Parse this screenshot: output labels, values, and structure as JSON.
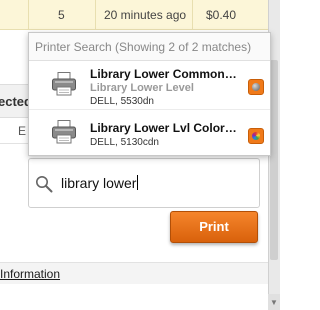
{
  "background_table": {
    "row": {
      "count": "5",
      "time": "20 minutes ago",
      "cost": "$0.40"
    },
    "left_header_fragment": "ected",
    "left_row_fragment": "E"
  },
  "printer_search": {
    "header": "Printer Search (Showing 2 of 2 matches)",
    "results": [
      {
        "name": "Library Lower Commons …",
        "location": "Library Lower Level",
        "model": "DELL, 5530dn",
        "status_icon": "mono-toner-icon"
      },
      {
        "name": "Library Lower Lvl Color Pr…",
        "location": "",
        "model": "DELL, 5130cdn",
        "status_icon": "color-toner-icon"
      }
    ]
  },
  "search": {
    "value": "library lower",
    "icon": "search-icon"
  },
  "print_button": {
    "label": "Print"
  },
  "footer": {
    "link": "Information"
  },
  "colors": {
    "accent": "#e86e12",
    "highlight_row": "#fcf6d8"
  }
}
